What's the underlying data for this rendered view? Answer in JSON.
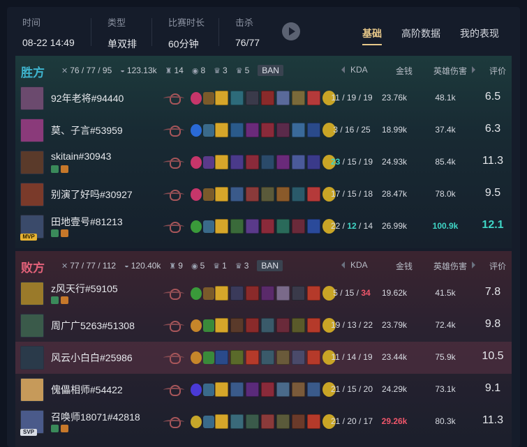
{
  "header": {
    "time_label": "时间",
    "time_value": "08-22 14:49",
    "type_label": "类型",
    "type_value": "单双排",
    "duration_label": "比赛时长",
    "duration_value": "60分钟",
    "kills_label": "击杀",
    "kills_value": "76/77",
    "tabs": [
      "基础",
      "高阶数据",
      "我的表现"
    ]
  },
  "columns": {
    "kda": "KDA",
    "gold": "金钱",
    "damage": "英雄伤害",
    "score": "评价"
  },
  "teams": [
    {
      "name": "胜方",
      "kda": "76 / 77 / 95",
      "gold": "123.13k",
      "towers": "14",
      "dragons": "8",
      "barons": "3",
      "heralds": "5",
      "ban_label": "BAN",
      "players": [
        {
          "name": "92年老将#94440",
          "kda": "11 / 19 / 19",
          "gold": "23.76k",
          "damage": "48.1k",
          "score": "6.5",
          "avatar": "#6b4a6e",
          "spell1": "#c6366a",
          "spell2": "#7a5a2a",
          "items": [
            "#d6a62a",
            "#2d6b7a",
            "#3a3a4a",
            "#8a2a2a",
            "#5a6a9a",
            "#7a6a3a",
            "#b53a3a"
          ]
        },
        {
          "name": "莫、子言#53959",
          "kda": "3 / 16 / 25",
          "gold": "18.99k",
          "damage": "37.4k",
          "score": "6.3",
          "avatar": "#8a3a7a",
          "spell1": "#2a6ad6",
          "spell2": "#3a6a8a",
          "items": [
            "#d6a62a",
            "#2a5a8a",
            "#6a2a7a",
            "#8a2a3a",
            "#5a2a4a",
            "#3a6a9a",
            "#2a4a8a"
          ]
        },
        {
          "name": "skitain#30943",
          "kda": "23 / 15 / 19",
          "kda_kills": "23",
          "kda_rest": " / 15 / 19",
          "gold": "24.93k",
          "damage": "85.4k",
          "score": "11.3",
          "avatar": "#5a3a2a",
          "spell1": "#c6366a",
          "spell2": "#5a3a8a",
          "items": [
            "#d6a62a",
            "#4a3a8a",
            "#8a2a3a",
            "#2a4a6a",
            "#6a2a7a",
            "#4a5a9a",
            "#3a3a8a"
          ]
        },
        {
          "name": "别演了好吗#30927",
          "kda": "17 / 15 / 18",
          "gold": "28.47k",
          "damage": "78.0k",
          "score": "9.5",
          "avatar": "#7a3a2a",
          "spell1": "#c6366a",
          "spell2": "#7a5a2a",
          "items": [
            "#d6a62a",
            "#3a5a8a",
            "#8a3a3a",
            "#5a5a3a",
            "#8a5a2a",
            "#2a5a6a",
            "#b53a3a"
          ]
        },
        {
          "name": "田地壹号#81213",
          "kda": "22 / 12 / 14",
          "kda_k": "22 / ",
          "kda_d": "12",
          "kda_a": " / 14",
          "gold": "26.99k",
          "damage": "100.9k",
          "score": "12.1",
          "mvp": "MVP",
          "avatar": "#3a4a6a",
          "spell1": "#3a9a3a",
          "spell2": "#3a6a8a",
          "items": [
            "#d6a62a",
            "#3a6a3a",
            "#5a3a8a",
            "#8a2a3a",
            "#2a6a5a",
            "#6a2a3a",
            "#2a4a9a"
          ]
        }
      ]
    },
    {
      "name": "败方",
      "kda": "77 / 77 / 112",
      "gold": "120.40k",
      "towers": "9",
      "dragons": "5",
      "barons": "1",
      "heralds": "3",
      "ban_label": "BAN",
      "players": [
        {
          "name": "z风天行#59105",
          "kda": "5 / 15 / 34",
          "kda_main": "5 / 15 / ",
          "kda_a": "34",
          "gold": "19.62k",
          "damage": "41.5k",
          "score": "7.8",
          "avatar": "#9a7a2a",
          "spell1": "#3a9a3a",
          "spell2": "#7a5a2a",
          "items": [
            "#d6a62a",
            "#3a3a5a",
            "#8a2a2a",
            "#5a2a6a",
            "#7a6a8a",
            "#3a3a4a",
            "#b53a2a"
          ]
        },
        {
          "name": "周广广5263#51308",
          "kda": "19 / 13 / 22",
          "gold": "23.79k",
          "damage": "72.4k",
          "score": "9.8",
          "avatar": "#3a5a4a",
          "spell1": "#c6862a",
          "spell2": "#3a8a3a",
          "items": [
            "#d6a62a",
            "#5a3a2a",
            "#8a2a2a",
            "#3a5a6a",
            "#6a2a3a",
            "#5a5a2a",
            "#b53a2a"
          ]
        },
        {
          "name": "风云小白白#25986",
          "kda": "11 / 14 / 19",
          "gold": "23.44k",
          "damage": "75.9k",
          "score": "10.5",
          "avatar": "#2a3a4a",
          "spell1": "#c6862a",
          "spell2": "#3a8a3a",
          "items": [
            "#2a4a8a",
            "#5a6a2a",
            "#b53a2a",
            "#3a5a6a",
            "#6a5a3a",
            "#4a4a6a",
            "#b53a2a"
          ]
        },
        {
          "name": "傀儡相师#54422",
          "kda": "21 / 15 / 20",
          "gold": "24.29k",
          "damage": "73.1k",
          "score": "9.1",
          "avatar": "#c69a5a",
          "spell1": "#4a3ad6",
          "spell2": "#3a6a8a",
          "items": [
            "#d6a62a",
            "#3a5a8a",
            "#5a2a7a",
            "#8a2a3a",
            "#4a6a8a",
            "#7a5a3a",
            "#3a5a8a"
          ]
        },
        {
          "name": "召唤师18071#42818",
          "kda": "21 / 20 / 17",
          "gold": "29.26k",
          "damage": "80.3k",
          "score": "11.3",
          "svp": "SVP",
          "avatar": "#4a5a8a",
          "spell1": "#c6a62a",
          "spell2": "#3a6a8a",
          "items": [
            "#d6a62a",
            "#3a6a7a",
            "#3a5a4a",
            "#8a3a3a",
            "#5a5a3a",
            "#6a3a2a",
            "#b53a2a"
          ]
        }
      ]
    }
  ]
}
